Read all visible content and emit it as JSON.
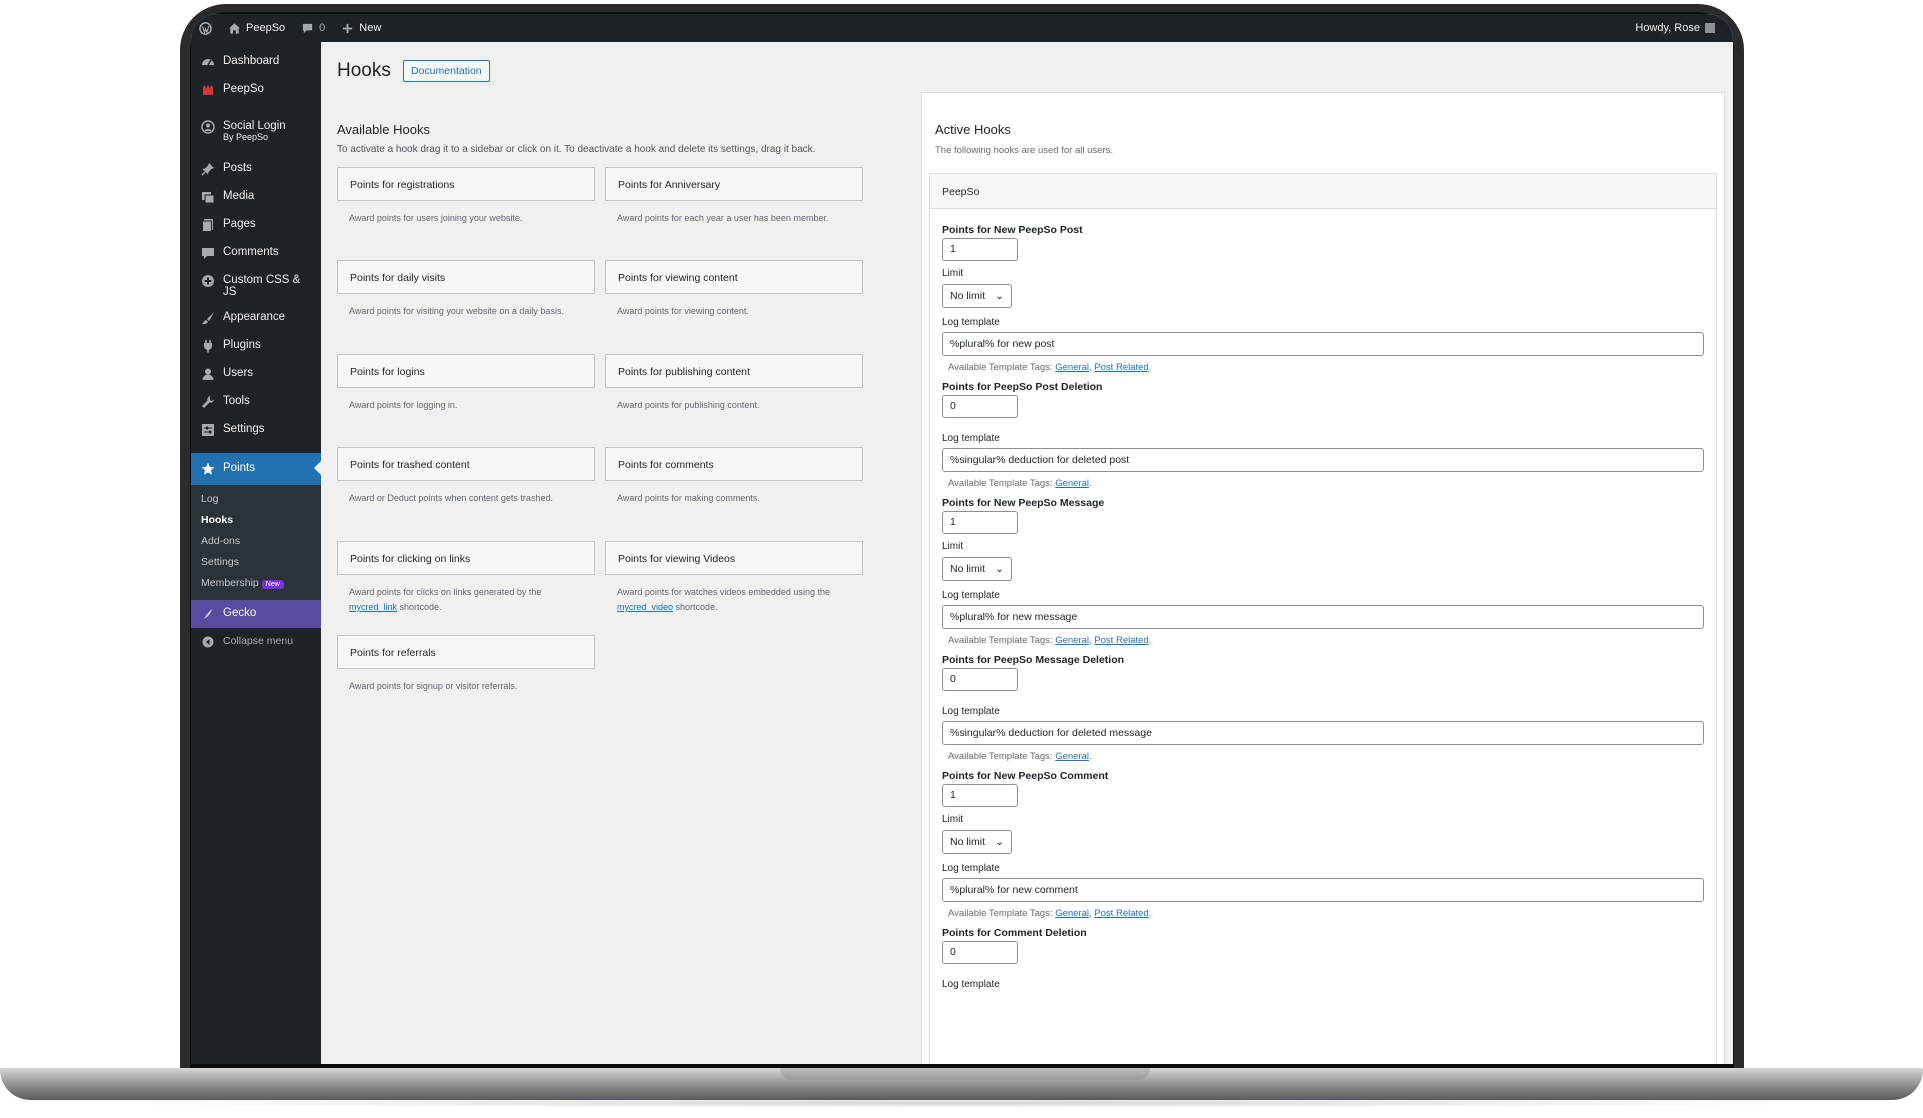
{
  "adminbar": {
    "site_name": "PeepSo",
    "comments_count": "0",
    "new_label": "New",
    "howdy": "Howdy, Rose"
  },
  "sidebar": {
    "items": [
      {
        "label": "Dashboard",
        "icon": "dashboard-icon"
      },
      {
        "label": "PeepSo",
        "icon": "peepso-icon"
      },
      {
        "label": "Social Login",
        "sublabel": "By PeepSo",
        "icon": "social-login-icon"
      },
      {
        "label": "Posts",
        "icon": "pin-icon"
      },
      {
        "label": "Media",
        "icon": "media-icon"
      },
      {
        "label": "Pages",
        "icon": "pages-icon"
      },
      {
        "label": "Comments",
        "icon": "comments-icon"
      },
      {
        "label": "Custom CSS & JS",
        "icon": "plus-circle-icon"
      },
      {
        "label": "Appearance",
        "icon": "brush-icon"
      },
      {
        "label": "Plugins",
        "icon": "plugins-icon"
      },
      {
        "label": "Users",
        "icon": "users-icon"
      },
      {
        "label": "Tools",
        "icon": "wrench-icon"
      },
      {
        "label": "Settings",
        "icon": "settings-icon"
      }
    ],
    "points": {
      "label": "Points",
      "icon": "star-icon"
    },
    "submenu": [
      "Log",
      "Hooks",
      "Add-ons",
      "Settings",
      "Membership"
    ],
    "membership_badge": "New",
    "gecko": "Gecko",
    "collapse": "Collapse menu"
  },
  "page": {
    "title": "Hooks",
    "doc_button": "Documentation",
    "available_title": "Available Hooks",
    "available_desc": "To activate a hook drag it to a sidebar or click on it. To deactivate a hook and delete its settings, drag it back."
  },
  "hooks": [
    {
      "name": "Points for registrations",
      "desc": "Award points for users joining your website."
    },
    {
      "name": "Points for Anniversary",
      "desc": "Award points for each year a user has been member."
    },
    {
      "name": "Points for daily visits",
      "desc": "Award points for visiting your website on a daily basis."
    },
    {
      "name": "Points for viewing content",
      "desc": "Award points for viewing content."
    },
    {
      "name": "Points for logins",
      "desc": "Award points for logging in."
    },
    {
      "name": "Points for publishing content",
      "desc": "Award points for publishing content."
    },
    {
      "name": "Points for trashed content",
      "desc": "Award or Deduct points when content gets trashed."
    },
    {
      "name": "Points for comments",
      "desc": "Award points for making comments."
    },
    {
      "name": "Points for clicking on links",
      "desc": "Award points for clicks on links generated by the",
      "link": "mycred_link",
      "desc_tail": "shortcode."
    },
    {
      "name": "Points for viewing Videos",
      "desc": "Award points for watches videos embedded using the",
      "link": "mycred_video",
      "desc_tail": "shortcode."
    },
    {
      "name": "Points for referrals",
      "desc": "Award points for signup or visitor referrals."
    }
  ],
  "active": {
    "title": "Active Hooks",
    "desc": "The following hooks are used for all users.",
    "panel_title": "PeepSo",
    "limit_label": "Limit",
    "log_label": "Log template",
    "tags_prefix": "Available Template Tags:",
    "tag_general": "General",
    "tag_post": "Post Related",
    "limit_value": "No limit",
    "fields": [
      {
        "label": "Points for New PeepSo Post",
        "value": "1",
        "template": "%plural% for new post"
      },
      {
        "label": "Points for PeepSo Post Deletion",
        "value": "0",
        "template": "%singular% deduction for deleted post"
      },
      {
        "label": "Points for New PeepSo Message",
        "value": "1",
        "template": "%plural% for new message"
      },
      {
        "label": "Points for PeepSo Message Deletion",
        "value": "0",
        "template": "%singular% deduction for deleted message"
      },
      {
        "label": "Points for New PeepSo Comment",
        "value": "1",
        "template": "%plural% for new comment"
      },
      {
        "label": "Points for Comment Deletion",
        "value": "0"
      }
    ]
  }
}
